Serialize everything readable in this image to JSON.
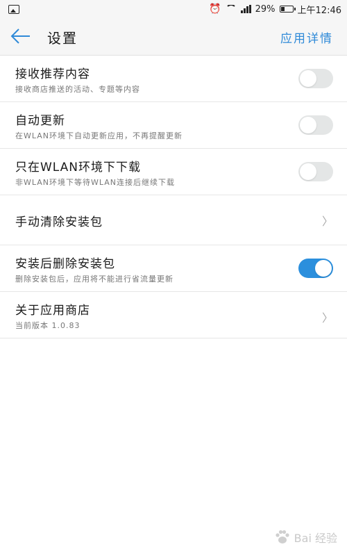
{
  "status_bar": {
    "battery": "29%",
    "time": "上午12:46",
    "icons": [
      "gallery-icon",
      "alarm-icon",
      "wifi-icon",
      "signal-icon",
      "battery-icon"
    ]
  },
  "header": {
    "title": "设置",
    "action": "应用详情",
    "back_icon": "arrow-left-icon"
  },
  "settings": [
    {
      "title": "接收推荐内容",
      "subtitle": "接收商店推送的活动、专题等内容",
      "control": "toggle",
      "on": false
    },
    {
      "title": "自动更新",
      "subtitle": "在WLAN环境下自动更新应用，不再提醒更新",
      "control": "toggle",
      "on": false
    },
    {
      "title": "只在WLAN环境下下载",
      "subtitle": "非WLAN环境下等待WLAN连接后继续下载",
      "control": "toggle",
      "on": false
    },
    {
      "title": "手动清除安装包",
      "subtitle": "",
      "control": "chevron"
    },
    {
      "title": "安装后删除安装包",
      "subtitle": "删除安装包后，应用将不能进行省流量更新",
      "control": "toggle",
      "on": true
    },
    {
      "title": "关于应用商店",
      "subtitle": "当前版本 1.0.83",
      "control": "chevron"
    }
  ],
  "watermark": {
    "text": "Bai 经验",
    "icon": "paw-icon"
  },
  "colors": {
    "accent": "#2b8fdd",
    "toggle_off": "#e4e6e6",
    "header_bg": "#f6f6f6"
  }
}
